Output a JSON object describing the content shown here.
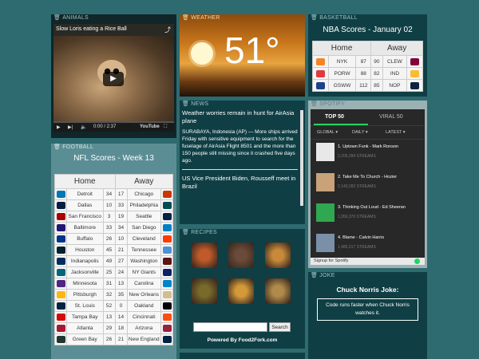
{
  "animals": {
    "header": "ANIMALS",
    "video_title": "Slow Loris eating a Rice Ball",
    "time": "0:00 / 2:37",
    "youtube_label": "YouTube",
    "progress": 0
  },
  "weather": {
    "header": "WEATHER",
    "temperature": "51°"
  },
  "basketball": {
    "header": "BASKETBALL",
    "title": "NBA Scores - January 02",
    "home_label": "Home",
    "away_label": "Away",
    "games": [
      {
        "home": "NYK",
        "hs": "87",
        "as": "90",
        "away": "CLEW",
        "hc": "#f58426",
        "ac": "#860038"
      },
      {
        "home": "PORW",
        "hs": "88",
        "as": "82",
        "away": "IND",
        "hc": "#e03a3e",
        "ac": "#fdbb30"
      },
      {
        "home": "GSWW",
        "hs": "112",
        "as": "85",
        "away": "NOP",
        "hc": "#1d428a",
        "ac": "#0c2340"
      }
    ]
  },
  "news": {
    "header": "NEWS",
    "headline1": "Weather worries remain in hunt for AirAsia plane",
    "body1": "SURABAYA, Indonesia (AP) — More ships arrived Friday with sensitive equipment to search for the fuselage of AirAsia Flight 8501 and the more than 150 people still missing since it crashed five days ago.",
    "headline2": "US Vice President Biden, Rousseff meet in Brazil"
  },
  "spotify": {
    "header": "SPOTIFY",
    "tab1": "TOP 50",
    "tab2": "VIRAL 50",
    "filter1": "GLOBAL",
    "filter2": "DAILY",
    "filter3": "LATEST",
    "tracks": [
      {
        "title": "1. Uptown Funk - Mark Ronson",
        "streams": "2,206,284 STREAMS",
        "color": "#e8e8e8"
      },
      {
        "title": "2. Take Me To Church - Hozier",
        "streams": "2,140,282 STREAMS",
        "color": "#c9a27a"
      },
      {
        "title": "3. Thinking Out Loud - Ed Sheeran",
        "streams": "1,950,370 STREAMS",
        "color": "#2fa84f"
      },
      {
        "title": "4. Blame - Calvin Harris",
        "streams": "1,485,217 STREAMS",
        "color": "#7a8fa8"
      }
    ],
    "footer": "Signup for Spotify"
  },
  "football": {
    "header": "FOOTBALL",
    "title": "NFL Scores - Week 13",
    "home_label": "Home",
    "away_label": "Away",
    "games": [
      {
        "home": "Detroit",
        "hs": "34",
        "as": "17",
        "away": "Chicago",
        "hc": "#0076b6",
        "ac": "#c83803"
      },
      {
        "home": "Dallas",
        "hs": "10",
        "as": "33",
        "away": "Philadelphia",
        "hc": "#041e42",
        "ac": "#004c54"
      },
      {
        "home": "San Francisco",
        "hs": "3",
        "as": "19",
        "away": "Seattle",
        "hc": "#aa0000",
        "ac": "#002244"
      },
      {
        "home": "Baltimore",
        "hs": "33",
        "as": "34",
        "away": "San Diego",
        "hc": "#241773",
        "ac": "#0080c6"
      },
      {
        "home": "Buffalo",
        "hs": "26",
        "as": "10",
        "away": "Cleveland",
        "hc": "#00338d",
        "ac": "#ff3c00"
      },
      {
        "home": "Houston",
        "hs": "45",
        "as": "21",
        "away": "Tennessee",
        "hc": "#03202f",
        "ac": "#4b92db"
      },
      {
        "home": "Indianapolis",
        "hs": "49",
        "as": "27",
        "away": "Washington",
        "hc": "#002c5f",
        "ac": "#5a1414"
      },
      {
        "home": "Jacksonville",
        "hs": "25",
        "as": "24",
        "away": "NY Giants",
        "hc": "#006778",
        "ac": "#0b2265"
      },
      {
        "home": "Minnesota",
        "hs": "31",
        "as": "13",
        "away": "Carolina",
        "hc": "#4f2683",
        "ac": "#0085ca"
      },
      {
        "home": "Pittsburgh",
        "hs": "32",
        "as": "35",
        "away": "New Orleans",
        "hc": "#ffb612",
        "ac": "#d3bc8d"
      },
      {
        "home": "St. Louis",
        "hs": "52",
        "as": "0",
        "away": "Oakland",
        "hc": "#002244",
        "ac": "#000000"
      },
      {
        "home": "Tampa Bay",
        "hs": "13",
        "as": "14",
        "away": "Cincinnati",
        "hc": "#d50a0a",
        "ac": "#fb4f14"
      },
      {
        "home": "Atlanta",
        "hs": "29",
        "as": "18",
        "away": "Arizona",
        "hc": "#a71930",
        "ac": "#97233f"
      },
      {
        "home": "Green Bay",
        "hs": "26",
        "as": "21",
        "away": "New England",
        "hc": "#203731",
        "ac": "#002244"
      }
    ]
  },
  "recipes": {
    "header": "RECIPES",
    "search_button": "Search",
    "powered_by": "Powered By Food2Fork.com",
    "images": [
      "#c05a2a",
      "#6b4a3a",
      "#c88a3a",
      "#7a6a2a",
      "#d49a3a",
      "#b08a4a"
    ]
  },
  "joke": {
    "header": "JOKE",
    "title": "Chuck Norris Joke:",
    "text": "Code runs faster when Chuck Norris watches it."
  }
}
